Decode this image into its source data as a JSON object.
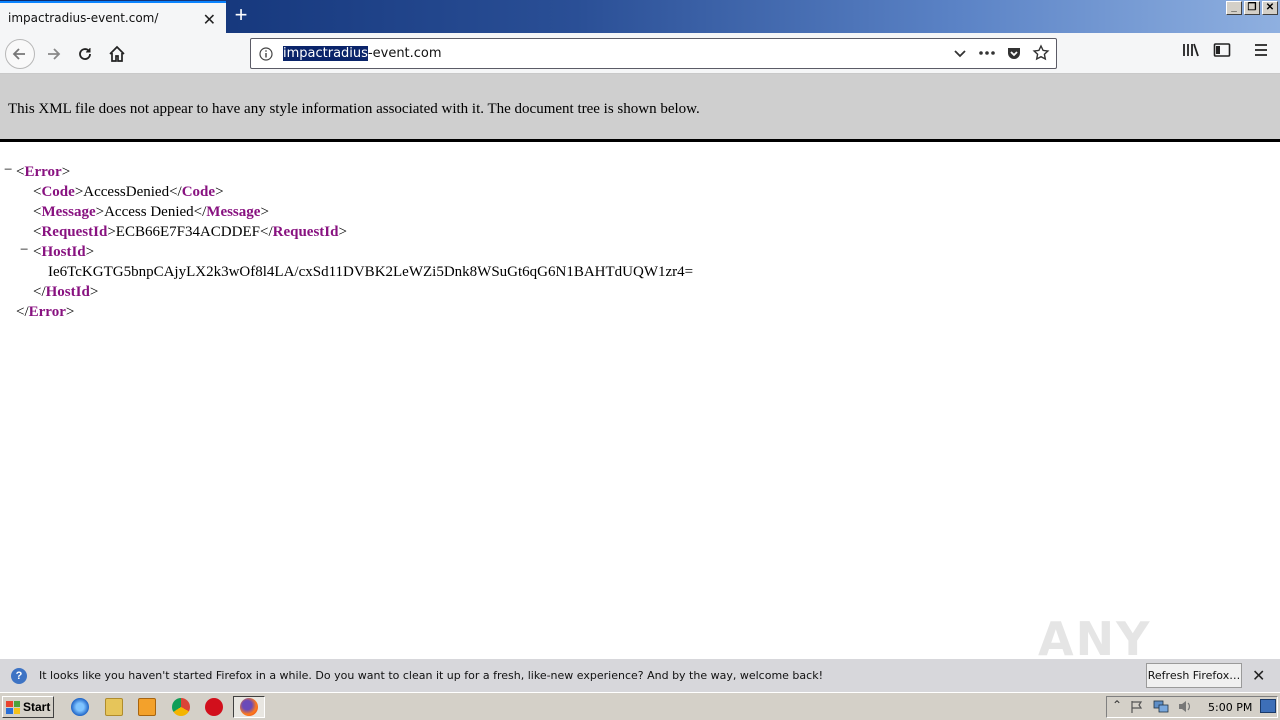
{
  "browser": {
    "tab_title": "impactradius-event.com/",
    "tab_close": "✕",
    "new_tab": "+",
    "window_buttons": [
      "_",
      "❐",
      "✕"
    ],
    "url_selected": "impactradius",
    "url_rest": "-event.com"
  },
  "xml_viewer": {
    "banner": "This XML file does not appear to have any style information associated with it. The document tree is shown below.",
    "collapse_symbol": "−",
    "error_tag": "Error",
    "code_tag": "Code",
    "code_value": "AccessDenied",
    "message_tag": "Message",
    "message_value": "Access Denied",
    "requestid_tag": "RequestId",
    "requestid_value": "ECB66E7F34ACDDEF",
    "hostid_tag": "HostId",
    "hostid_value": "Ie6TcKGTG5bnpCAjyLX2k3wOf8l4LA/cxSd11DVBK2LeWZi5Dnk8WSuGt6qG6N1BAHTdUQW1zr4="
  },
  "notification": {
    "icon": "?",
    "text": "It looks like you haven't started Firefox in a while. Do you want to clean it up for a fresh, like-new experience? And by the way, welcome back!",
    "button": "Refresh Firefox…",
    "close": "✕"
  },
  "watermark": "ANY RUN",
  "taskbar": {
    "start_label": "Start",
    "clock": "5:00 PM"
  },
  "colors": {
    "xml_tag": "#881280",
    "banner_bg": "#cfcfcf",
    "tab_accent": "#0a84ff"
  }
}
